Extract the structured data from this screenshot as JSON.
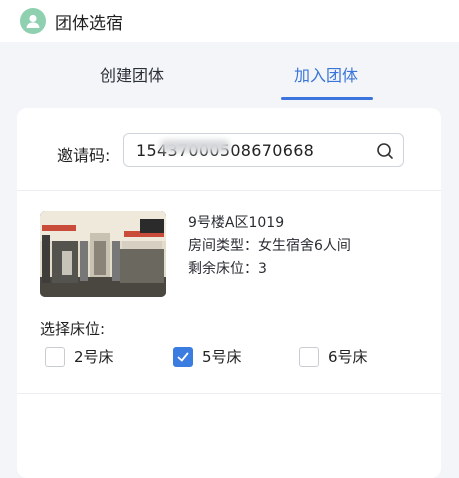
{
  "header": {
    "title": "团体选宿",
    "icon": "user-avatar-icon"
  },
  "tabs": [
    {
      "label": "创建团体",
      "active": false
    },
    {
      "label": "加入团体",
      "active": true
    }
  ],
  "colors": {
    "accent": "#3975d8",
    "avatar": "#8fd0b1"
  },
  "invite": {
    "label": "邀请码:",
    "value": "15437000508670668"
  },
  "room": {
    "name": "9号楼A区1019",
    "type": "房间类型：女生宿舍6人间",
    "remaining": "剩余床位：3"
  },
  "beds": {
    "label": "选择床位:",
    "options": [
      {
        "label": "2号床",
        "checked": false
      },
      {
        "label": "5号床",
        "checked": true
      },
      {
        "label": "6号床",
        "checked": false
      }
    ]
  }
}
